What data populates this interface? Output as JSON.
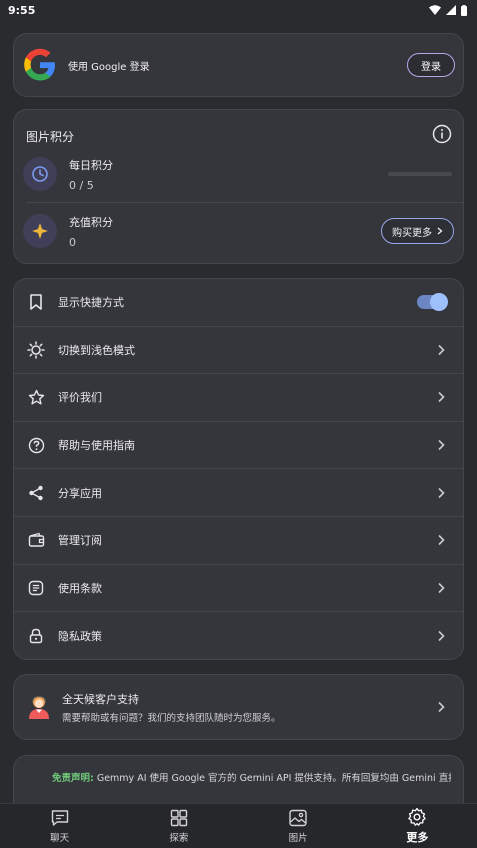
{
  "status_bar": {
    "time": "9:55"
  },
  "login": {
    "text": "使用 Google 登录",
    "button": "登录"
  },
  "points": {
    "title": "图片积分",
    "daily": {
      "label": "每日积分",
      "value": "0 / 5",
      "progress": 0
    },
    "recharge": {
      "label": "充值积分",
      "value": "0",
      "button": "购买更多"
    }
  },
  "settings": {
    "items": [
      {
        "label": "显示快捷方式",
        "icon": "bookmark-icon",
        "control": "toggle",
        "toggle_on": true
      },
      {
        "label": "切换到浅色模式",
        "icon": "sun-icon",
        "control": "chevron"
      },
      {
        "label": "评价我们",
        "icon": "star-icon",
        "control": "chevron"
      },
      {
        "label": "帮助与使用指南",
        "icon": "help-icon",
        "control": "chevron"
      },
      {
        "label": "分享应用",
        "icon": "share-icon",
        "control": "chevron"
      },
      {
        "label": "管理订阅",
        "icon": "wallet-icon",
        "control": "chevron"
      },
      {
        "label": "使用条款",
        "icon": "document-icon",
        "control": "chevron"
      },
      {
        "label": "隐私政策",
        "icon": "lock-icon",
        "control": "chevron"
      }
    ]
  },
  "support": {
    "title": "全天候客户支持",
    "subtitle": "需要帮助或有问题？我们的支持团队随时为您服务。"
  },
  "disclaimer": {
    "head": "免责声明:",
    "body": " Gemmy AI 使用 Google 官方的 Gemini API 提供支持。所有回复均由 Gemini 直接"
  },
  "nav": {
    "items": [
      {
        "label": "聊天",
        "icon": "chat-icon",
        "active": false
      },
      {
        "label": "探索",
        "icon": "explore-icon",
        "active": false
      },
      {
        "label": "图片",
        "icon": "image-icon",
        "active": false
      },
      {
        "label": "更多",
        "icon": "settings-icon",
        "active": true
      }
    ]
  },
  "colors": {
    "accent": "#8ab4f8",
    "background": "#2a2b2f",
    "card": "#35363b",
    "disclaimer_green": "#6fc77a"
  }
}
